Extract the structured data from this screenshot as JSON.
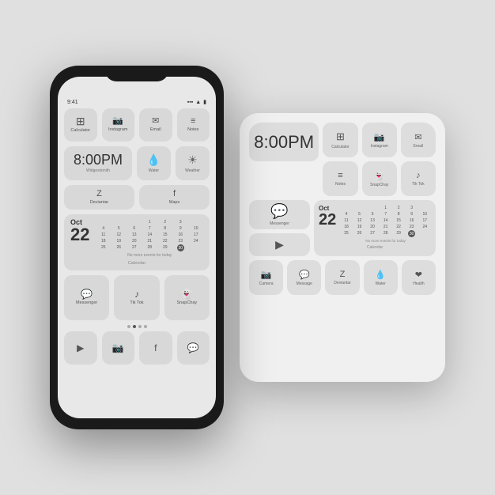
{
  "background": "#e0e0e0",
  "phone": {
    "time_display": "8:00PM",
    "widgetsmith_label": "Widgestsmith",
    "water_label": "Water",
    "weather_label": "Weather",
    "deviantar_label": "Deviantar",
    "maps_label": "Maps",
    "calendar_label": "Calendar",
    "calendar_month": "Oct",
    "calendar_day": "22",
    "no_events": "No more events for today",
    "messenger_label": "Messenger",
    "tiktok_label": "Tik Tok",
    "snapchay_label": "SnapChay",
    "apps_row1": [
      {
        "label": "Calculator",
        "icon": "⊞"
      },
      {
        "label": "Instagram",
        "icon": "◻"
      },
      {
        "label": "Email",
        "icon": "✉"
      },
      {
        "label": "Notes",
        "icon": "≡"
      }
    ],
    "bottom_row": [
      {
        "label": "",
        "icon": "▶"
      },
      {
        "label": "",
        "icon": "📷"
      },
      {
        "label": "",
        "icon": "f"
      },
      {
        "label": "",
        "icon": "💬"
      }
    ],
    "cal_days_header": [
      "",
      "1",
      "2",
      "3"
    ],
    "cal_week1": [
      "4",
      "5",
      "6",
      "7",
      "8",
      "9",
      "10"
    ],
    "cal_week2": [
      "11",
      "12",
      "13",
      "14",
      "15",
      "16",
      "17"
    ],
    "cal_week3": [
      "18",
      "19",
      "20",
      "21",
      "22",
      "23",
      "24"
    ],
    "cal_week4": [
      "25",
      "26",
      "27",
      "28",
      "29",
      "30",
      ""
    ]
  },
  "tablet": {
    "time_display": "8:00PM",
    "calculator_label": "Calculator",
    "instagram_label": "Instagram",
    "email_label": "Email",
    "notes_label": "Notes",
    "snapchay_label": "SnapChay",
    "tiktok_label": "Tik Tok",
    "messenger_label": "Messenger",
    "calendar_label": "Calendar",
    "calendar_month": "Oct",
    "calendar_day": "22",
    "no_events": "No more events for today",
    "camera_label": "Camera",
    "message_label": "Message",
    "deviantar_label": "Deviantar",
    "water_label": "Water",
    "health_label": "Health",
    "cal_week1": [
      "4",
      "5",
      "6",
      "7",
      "8",
      "9",
      "10"
    ],
    "cal_week2": [
      "11",
      "12",
      "13",
      "14",
      "15",
      "16",
      "17"
    ],
    "cal_week3": [
      "18",
      "19",
      "20",
      "21",
      "22",
      "23",
      "24"
    ],
    "cal_week4": [
      "25",
      "26",
      "27",
      "28",
      "29",
      "30",
      ""
    ]
  }
}
